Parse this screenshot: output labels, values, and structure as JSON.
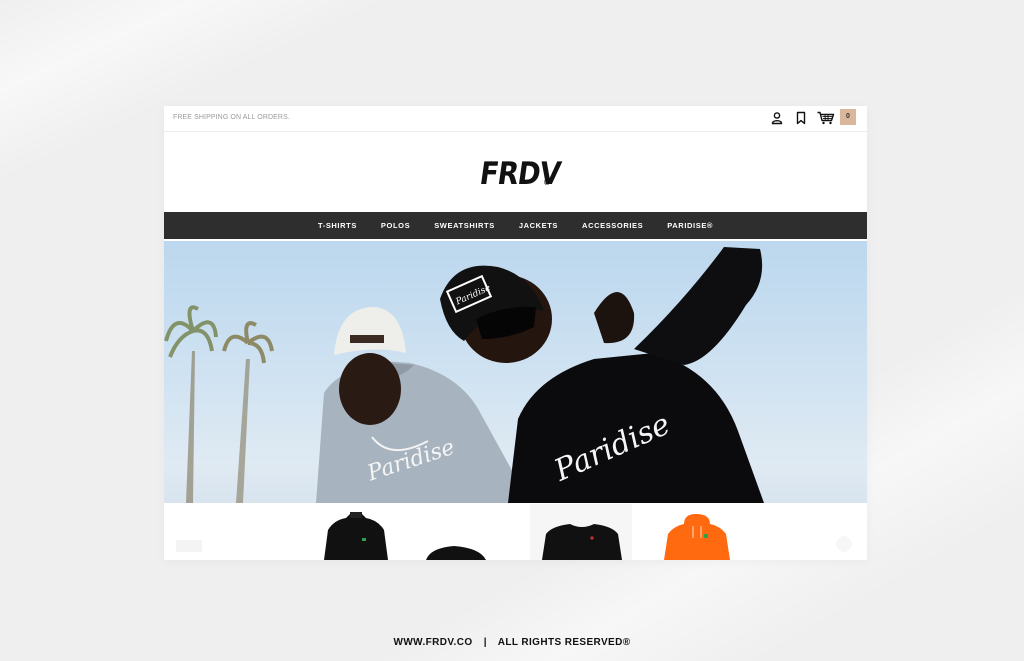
{
  "topbar": {
    "shipping_text": "FREE SHIPPING ON ALL ORDERS.",
    "cart_count": "0",
    "icons": [
      "user-icon",
      "bookmark-icon",
      "cart-icon"
    ]
  },
  "brand": {
    "logo_text": "FRDV",
    "logo_mark": "®"
  },
  "nav": {
    "items": [
      {
        "label": "T-SHIRTS"
      },
      {
        "label": "POLOS"
      },
      {
        "label": "SWEATSHIRTS"
      },
      {
        "label": "JACKETS"
      },
      {
        "label": "ACCESSORIES"
      },
      {
        "label": "PARIDISE®"
      }
    ]
  },
  "hero": {
    "shirt_text_left": "Paridise",
    "shirt_text_right": "Paridise",
    "cap_text": "Paridise"
  },
  "products": {
    "items": [
      {
        "name": "black-jacket",
        "color": "#111111"
      },
      {
        "name": "black-cap",
        "color": "#111111"
      },
      {
        "name": "black-tshirt",
        "color": "#111111"
      },
      {
        "name": "orange-hoodie",
        "color": "#ff6a10"
      }
    ]
  },
  "colors": {
    "nav_bg": "#2e2e2e",
    "cart_badge": "#d9b79a",
    "page_bg": "#efefef"
  },
  "footer": {
    "site": "WWW.FRDV.CO",
    "separator": "|",
    "rights": "ALL RIGHTS RESERVED®"
  }
}
